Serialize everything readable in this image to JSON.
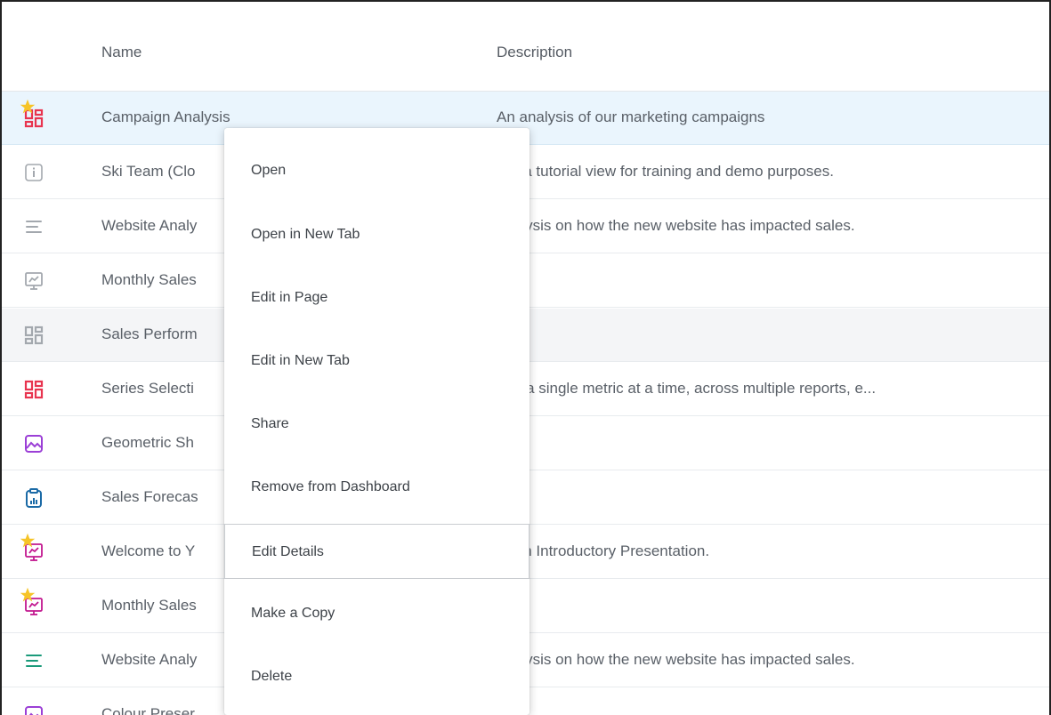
{
  "table": {
    "columns": {
      "name": "Name",
      "description": "Description"
    },
    "rows": [
      {
        "name": "Campaign Analysis",
        "description": "An analysis of our marketing campaigns",
        "icon": "dashboard-icon",
        "icon_color": "#e8344f",
        "starred": true
      },
      {
        "name": "Ski Team (Clo",
        "description": "s is a tutorial view for training and demo purposes.",
        "icon": "info-icon",
        "icon_color": "#a3a8ae",
        "starred": false
      },
      {
        "name": "Website Analy",
        "description": "analysis on how the new website has impacted sales.",
        "icon": "story-icon",
        "icon_color": "#a3a8ae",
        "starred": false
      },
      {
        "name": "Monthly Sales",
        "description": "",
        "icon": "presentation-icon",
        "icon_color": "#a3a8ae",
        "starred": false
      },
      {
        "name": "Sales Perform",
        "description": "",
        "icon": "dashboard-icon",
        "icon_color": "#a3a8ae",
        "starred": false
      },
      {
        "name": "Series Selecti",
        "description": "lore a single metric at a time, across multiple reports, e...",
        "icon": "dashboard-icon",
        "icon_color": "#e8344f",
        "starred": false
      },
      {
        "name": "Geometric Sh",
        "description": "",
        "icon": "image-icon",
        "icon_color": "#9b3fd6",
        "starred": false
      },
      {
        "name": "Sales Forecas",
        "description": "",
        "icon": "report-icon",
        "icon_color": "#1b6aa6",
        "starred": false
      },
      {
        "name": "Welcome to Y",
        "description": "owfin Introductory Presentation.",
        "icon": "presentation-icon",
        "icon_color": "#c2178f",
        "starred": true
      },
      {
        "name": "Monthly Sales",
        "description": "",
        "icon": "presentation-icon",
        "icon_color": "#c2178f",
        "starred": true
      },
      {
        "name": "Website Analy",
        "description": "analysis on how the new website has impacted sales.",
        "icon": "story-icon",
        "icon_color": "#1a9a7a",
        "starred": false
      },
      {
        "name": "Colour Preser",
        "description": "",
        "icon": "image-icon",
        "icon_color": "#9b3fd6",
        "starred": false
      }
    ]
  },
  "context_menu": {
    "items": [
      "Open",
      "Open in New Tab",
      "Edit in Page",
      "Edit in New Tab",
      "Share",
      "Remove from Dashboard",
      "Edit Details",
      "Make a Copy",
      "Delete"
    ],
    "active_item": "Edit Details"
  },
  "colors": {
    "selected_row": "#eaf5fd",
    "hover_row": "#f4f5f7",
    "star": "#f6c428"
  }
}
